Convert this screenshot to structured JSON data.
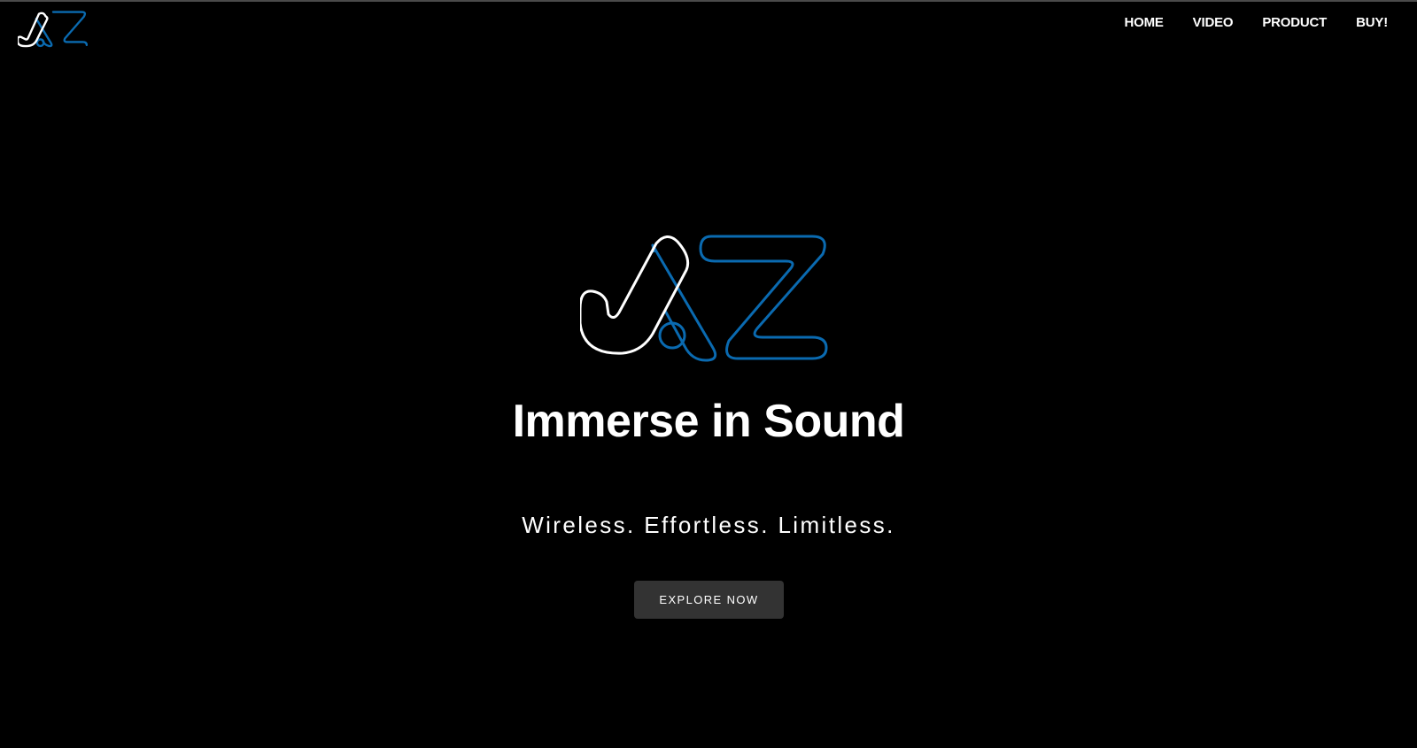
{
  "header": {
    "logo_icon": "jaz-logo-icon",
    "nav": [
      {
        "label": "HOME"
      },
      {
        "label": "VIDEO"
      },
      {
        "label": "PRODUCT"
      },
      {
        "label": "BUY!"
      }
    ]
  },
  "hero": {
    "logo_icon": "jaz-logo-icon",
    "headline": "Immerse in Sound",
    "tagline": "Wireless. Effortless. Limitless.",
    "cta_label": "EXPLORE NOW"
  },
  "colors": {
    "background": "#000000",
    "text": "#ffffff",
    "accent_blue": "#0a6ab0",
    "button_bg": "#333333"
  }
}
